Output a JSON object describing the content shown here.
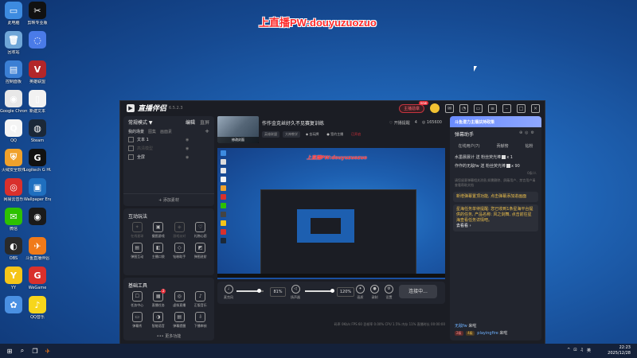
{
  "desktop": {
    "banner": "上直播PW:douyuzuozuo",
    "icons": [
      {
        "label": "此电脑",
        "glyph": "▭",
        "color": "#3d8be0"
      },
      {
        "label": "回收站",
        "glyph": "🗑",
        "color": "#6fa6d8"
      },
      {
        "label": "控制面板",
        "glyph": "▤",
        "color": "#3b7fd4"
      },
      {
        "label": "Google Chrome",
        "glyph": "◉",
        "color": "#e8e8e8"
      },
      {
        "label": "QQ",
        "glyph": "Q",
        "color": "#f4f4f4"
      },
      {
        "label": "火绒安全软件",
        "glyph": "⛨",
        "color": "#f0a12b"
      },
      {
        "label": "网易云音乐",
        "glyph": "◎",
        "color": "#d9302c"
      },
      {
        "label": "微信",
        "glyph": "✉",
        "color": "#2dc100"
      },
      {
        "label": "OBS",
        "glyph": "◐",
        "color": "#2a2a2a"
      },
      {
        "label": "YY",
        "glyph": "Y",
        "color": "#f5c518"
      },
      {
        "label": "",
        "glyph": "✿",
        "color": "#4a90e2"
      },
      {
        "label": "剪映专业版",
        "glyph": "✂",
        "color": "#111111"
      },
      {
        "label": "",
        "glyph": "◌",
        "color": "#4a7be8"
      },
      {
        "label": "英雄联盟",
        "glyph": "V",
        "color": "#b3262a"
      },
      {
        "label": "新建文本",
        "glyph": "▯",
        "color": "#f2f2f2"
      },
      {
        "label": "Steam",
        "glyph": "◍",
        "color": "#1b2838"
      },
      {
        "label": "Logitech G HUB",
        "glyph": "G",
        "color": "#111111"
      },
      {
        "label": "Wallpaper Engine",
        "glyph": "▣",
        "color": "#1f6fbf"
      },
      {
        "label": "",
        "glyph": "◉",
        "color": "#1a1a1a"
      },
      {
        "label": "斗鱼直播伴侣",
        "glyph": "✈",
        "color": "#f07a1a"
      },
      {
        "label": "WeGame",
        "glyph": "G",
        "color": "#d9302c"
      },
      {
        "label": "QQ音乐",
        "glyph": "♪",
        "color": "#f7d61c"
      }
    ]
  },
  "app": {
    "name": "直播伴侣",
    "version": "6.5.2.3",
    "topbar": {
      "host_btn": "主播勋章",
      "new_tag": "new"
    },
    "left": {
      "mode": "常规模式 ▼",
      "edit": "编辑",
      "dir": "直屏",
      "scene_tabs": [
        "我的场景",
        "图集",
        "画面素"
      ],
      "sources": [
        {
          "label": "文本 1",
          "dim": false
        },
        {
          "label": "高清模型",
          "dim": true
        },
        {
          "label": "全屏",
          "dim": false
        }
      ],
      "add_source": "+ 添加素材",
      "interact_title": "互动玩法",
      "interact": [
        {
          "label": "在线星球",
          "glyph": "✦",
          "dim": true
        },
        {
          "label": "摄图游戏",
          "glyph": "▣",
          "dim": false
        },
        {
          "label": "游戏派对",
          "glyph": "◈",
          "dim": true
        },
        {
          "label": "礼物心愿",
          "glyph": "♡",
          "dim": false
        },
        {
          "label": "弹图互动",
          "glyph": "▤",
          "dim": false
        },
        {
          "label": "主播口袋",
          "glyph": "◧",
          "dim": false
        },
        {
          "label": "钻粉助手",
          "glyph": "◇",
          "dim": false
        },
        {
          "label": "弹图进阶",
          "glyph": "◩",
          "dim": false
        }
      ],
      "tools_title": "基础工具",
      "tools": [
        {
          "label": "任务中心",
          "glyph": "☐",
          "badge": ""
        },
        {
          "label": "直播任务",
          "glyph": "▦",
          "badge": "2"
        },
        {
          "label": "虚拟直播",
          "glyph": "◎",
          "badge": ""
        },
        {
          "label": "正版音乐",
          "glyph": "♪",
          "badge": ""
        },
        {
          "label": "弹幕秀",
          "glyph": "▭",
          "badge": ""
        },
        {
          "label": "智能语音",
          "glyph": "◑",
          "badge": ""
        },
        {
          "label": "弹幕提醒",
          "glyph": "▤",
          "badge": ""
        },
        {
          "label": "下播审核",
          "glyph": "⇩",
          "badge": ""
        }
      ],
      "more": "••• 更多功能"
    },
    "stream": {
      "cover_btn": "修改封面",
      "title": "作作金克丝好久不见赛复训练",
      "tags": [
        "英雄联盟",
        "大神教学"
      ],
      "chip1": "◆ 金玩牌",
      "chip2": "● 签约主播",
      "chip3": "已开启",
      "stats": [
        "♡ 开播提醒",
        "4",
        "◎ 165600"
      ]
    },
    "preview": {
      "banner": "上直播PW:douyuzuozuo"
    },
    "controls": {
      "mic_label": "麦克风",
      "mic_vol": "81%",
      "mic_level": 0.81,
      "spk_label": "扬声器",
      "spk_vol": "120%",
      "spk_level": 1.0,
      "btn1": "画质",
      "btn2": "录制",
      "btn3": "设置",
      "go_live": "连接中..."
    },
    "status": "码率 0Kb/s   FPS 60   丢帧率 0.00%   CPU 1.5%   内存 11%   直播时长 00:00:00",
    "right": {
      "promo": "斗鱼潜力主播扶持政策",
      "header": "弹幕助手",
      "tabs": [
        "在线用户(7)",
        "贡献榜",
        "钻粉"
      ],
      "messages": [
        {
          "text": "水墨晨晨计 送 粉丝荧光棒",
          "qty": "x 1"
        },
        {
          "text": "作作的无敌fw 送 粉丝荧光棒",
          "qty": "x 90"
        }
      ],
      "count": "0条/人",
      "note": "请您留意弹幕相关消息,如需删除、屏蔽用户、禁言用户请查看帮助文档",
      "notice1": "新增弹幕置顶功能, 点击弹幕添加进画面",
      "notice2": "星海任务单待提醒: 您已收到1条星海平台提供的任务, 产品名称: 风之剑舞, 点击前往星海查看任务详情吧。",
      "notice_link": "去看看 ›",
      "chat": [
        {
          "name": "无敌fw",
          "text": "来啦",
          "level": "",
          "level_class": ""
        },
        {
          "name": "playingfire",
          "text": "来啦",
          "level": "2级",
          "level_class": "a"
        },
        {
          "name": "",
          "text": "",
          "level": "",
          "level_class": ""
        }
      ],
      "chat_levels": [
        "2级",
        "4级"
      ]
    }
  },
  "taskbar": {
    "time": "22:23",
    "date": "2025/12/28",
    "tray": [
      "^",
      "⊡",
      "♫",
      "英"
    ]
  }
}
